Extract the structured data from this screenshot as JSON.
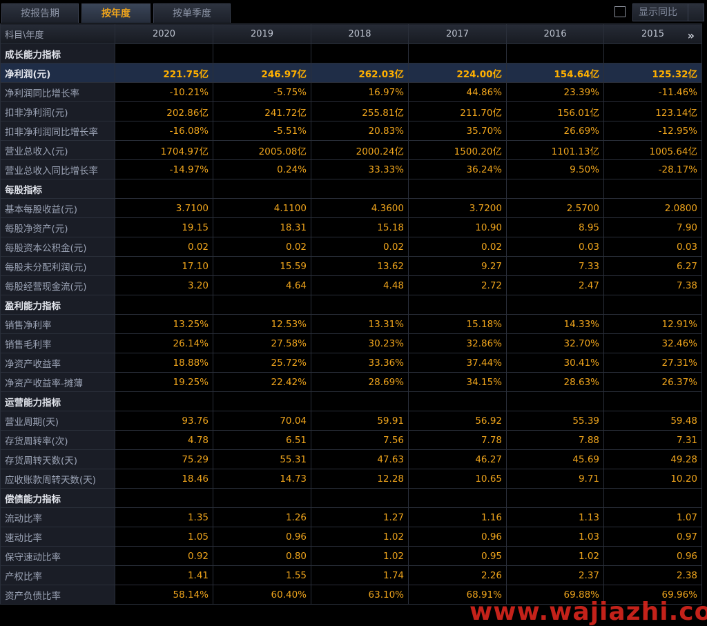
{
  "tabs": [
    {
      "label": "按报告期",
      "active": false
    },
    {
      "label": "按年度",
      "active": true
    },
    {
      "label": "按单季度",
      "active": false
    }
  ],
  "yoy_toggle": {
    "label": "显示同比",
    "checked": false
  },
  "table": {
    "corner_label": "科目\\年度",
    "years": [
      "2020",
      "2019",
      "2018",
      "2017",
      "2016",
      "2015"
    ],
    "rows": [
      {
        "type": "section",
        "label": "成长能力指标"
      },
      {
        "type": "highlight",
        "label": "净利润(元)",
        "values": [
          "221.75亿",
          "246.97亿",
          "262.03亿",
          "224.00亿",
          "154.64亿",
          "125.32亿"
        ]
      },
      {
        "type": "data",
        "label": "净利润同比增长率",
        "values": [
          "-10.21%",
          "-5.75%",
          "16.97%",
          "44.86%",
          "23.39%",
          "-11.46%"
        ]
      },
      {
        "type": "data",
        "label": "扣非净利润(元)",
        "values": [
          "202.86亿",
          "241.72亿",
          "255.81亿",
          "211.70亿",
          "156.01亿",
          "123.14亿"
        ]
      },
      {
        "type": "data",
        "label": "扣非净利润同比增长率",
        "values": [
          "-16.08%",
          "-5.51%",
          "20.83%",
          "35.70%",
          "26.69%",
          "-12.95%"
        ]
      },
      {
        "type": "data",
        "label": "营业总收入(元)",
        "values": [
          "1704.97亿",
          "2005.08亿",
          "2000.24亿",
          "1500.20亿",
          "1101.13亿",
          "1005.64亿"
        ]
      },
      {
        "type": "data",
        "label": "营业总收入同比增长率",
        "values": [
          "-14.97%",
          "0.24%",
          "33.33%",
          "36.24%",
          "9.50%",
          "-28.17%"
        ]
      },
      {
        "type": "section",
        "label": "每股指标"
      },
      {
        "type": "data",
        "label": "基本每股收益(元)",
        "values": [
          "3.7100",
          "4.1100",
          "4.3600",
          "3.7200",
          "2.5700",
          "2.0800"
        ]
      },
      {
        "type": "data",
        "label": "每股净资产(元)",
        "values": [
          "19.15",
          "18.31",
          "15.18",
          "10.90",
          "8.95",
          "7.90"
        ]
      },
      {
        "type": "data",
        "label": "每股资本公积金(元)",
        "values": [
          "0.02",
          "0.02",
          "0.02",
          "0.02",
          "0.03",
          "0.03"
        ]
      },
      {
        "type": "data",
        "label": "每股未分配利润(元)",
        "values": [
          "17.10",
          "15.59",
          "13.62",
          "9.27",
          "7.33",
          "6.27"
        ]
      },
      {
        "type": "data",
        "label": "每股经营现金流(元)",
        "values": [
          "3.20",
          "4.64",
          "4.48",
          "2.72",
          "2.47",
          "7.38"
        ]
      },
      {
        "type": "section",
        "label": "盈利能力指标"
      },
      {
        "type": "data",
        "label": "销售净利率",
        "values": [
          "13.25%",
          "12.53%",
          "13.31%",
          "15.18%",
          "14.33%",
          "12.91%"
        ]
      },
      {
        "type": "data",
        "label": "销售毛利率",
        "values": [
          "26.14%",
          "27.58%",
          "30.23%",
          "32.86%",
          "32.70%",
          "32.46%"
        ]
      },
      {
        "type": "data",
        "label": "净资产收益率",
        "values": [
          "18.88%",
          "25.72%",
          "33.36%",
          "37.44%",
          "30.41%",
          "27.31%"
        ]
      },
      {
        "type": "data",
        "label": "净资产收益率-摊薄",
        "values": [
          "19.25%",
          "22.42%",
          "28.69%",
          "34.15%",
          "28.63%",
          "26.37%"
        ]
      },
      {
        "type": "section",
        "label": "运营能力指标"
      },
      {
        "type": "data",
        "label": "营业周期(天)",
        "values": [
          "93.76",
          "70.04",
          "59.91",
          "56.92",
          "55.39",
          "59.48"
        ]
      },
      {
        "type": "data",
        "label": "存货周转率(次)",
        "values": [
          "4.78",
          "6.51",
          "7.56",
          "7.78",
          "7.88",
          "7.31"
        ]
      },
      {
        "type": "data",
        "label": "存货周转天数(天)",
        "values": [
          "75.29",
          "55.31",
          "47.63",
          "46.27",
          "45.69",
          "49.28"
        ]
      },
      {
        "type": "data",
        "label": "应收账款周转天数(天)",
        "values": [
          "18.46",
          "14.73",
          "12.28",
          "10.65",
          "9.71",
          "10.20"
        ]
      },
      {
        "type": "section",
        "label": "偿债能力指标"
      },
      {
        "type": "data",
        "label": "流动比率",
        "values": [
          "1.35",
          "1.26",
          "1.27",
          "1.16",
          "1.13",
          "1.07"
        ]
      },
      {
        "type": "data",
        "label": "速动比率",
        "values": [
          "1.05",
          "0.96",
          "1.02",
          "0.96",
          "1.03",
          "0.97"
        ]
      },
      {
        "type": "data",
        "label": "保守速动比率",
        "values": [
          "0.92",
          "0.80",
          "1.02",
          "0.95",
          "1.02",
          "0.96"
        ]
      },
      {
        "type": "data",
        "label": "产权比率",
        "values": [
          "1.41",
          "1.55",
          "1.74",
          "2.26",
          "2.37",
          "2.38"
        ]
      },
      {
        "type": "data",
        "label": "资产负债比率",
        "values": [
          "58.14%",
          "60.40%",
          "63.10%",
          "68.91%",
          "69.88%",
          "69.96%"
        ]
      }
    ]
  },
  "watermark": "www.wajiazhi.com",
  "colors": {
    "accent": "#f0a51c",
    "label_bg": "#1a1d26",
    "highlight_bg": "#1f2d47"
  }
}
